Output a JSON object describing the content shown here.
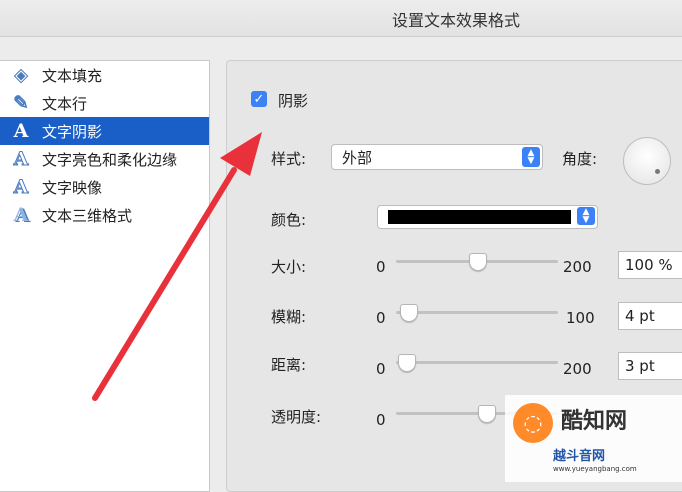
{
  "window": {
    "title": "设置文本效果格式"
  },
  "sidebar": {
    "items": [
      {
        "label": "文本填充",
        "icon": "paint-bucket-icon",
        "glyph": "◈"
      },
      {
        "label": "文本行",
        "icon": "pen-icon",
        "glyph": "✎"
      },
      {
        "label": "文字阴影",
        "icon": "text-shadow-icon",
        "glyph": "A",
        "selected": true
      },
      {
        "label": "文字亮色和柔化边缘",
        "icon": "text-glow-icon",
        "glyph": "A"
      },
      {
        "label": "文字映像",
        "icon": "text-reflection-icon",
        "glyph": "A"
      },
      {
        "label": "文本三维格式",
        "icon": "text-3d-icon",
        "glyph": "A"
      }
    ]
  },
  "shadow": {
    "enabled_label": "阴影",
    "style_label": "样式:",
    "style_value": "外部",
    "angle_label": "角度:",
    "color_label": "颜色:",
    "color_value": "#000000",
    "size": {
      "label": "大小:",
      "min": "0",
      "max": "200",
      "value": "100 %",
      "level": 100
    },
    "blur": {
      "label": "模糊:",
      "min": "0",
      "max": "100",
      "value": "4 pt",
      "level": 4
    },
    "distance": {
      "label": "距离:",
      "min": "0",
      "max": "200",
      "value": "3 pt",
      "level": 3
    },
    "transparency": {
      "label": "透明度:",
      "min": "0"
    }
  },
  "watermark": {
    "brand": "酷知网",
    "sub": "越斗音网",
    "url": "www.yueyangbang.com"
  },
  "colors": {
    "accent": "#3b82f6",
    "selection": "#1a5fc8",
    "annotation_arrow": "#e8313a"
  }
}
